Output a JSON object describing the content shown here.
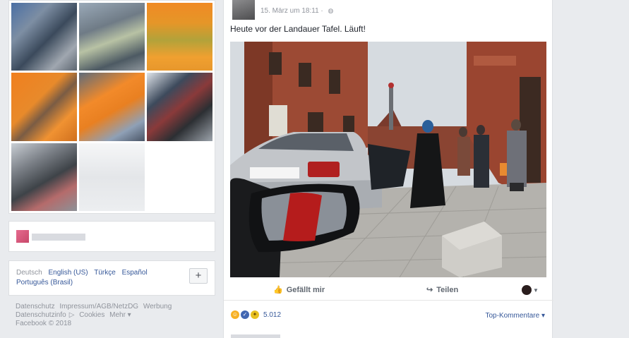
{
  "left": {
    "photos": [
      {
        "name": "photo-1"
      },
      {
        "name": "photo-2"
      },
      {
        "name": "photo-3"
      },
      {
        "name": "photo-4"
      },
      {
        "name": "photo-5"
      },
      {
        "name": "photo-6"
      },
      {
        "name": "photo-7"
      },
      {
        "name": "photo-8"
      },
      {
        "name": "photo-9"
      }
    ],
    "languages": [
      "Deutsch",
      "English (US)",
      "Türkçe",
      "Español",
      "Português (Brasil)"
    ],
    "lang_plus": "+",
    "footer": [
      "Datenschutz",
      "Impressum/AGB/NetzDG",
      "Werbung",
      "Datenschutzinfo",
      "Cookies",
      "Mehr ▾"
    ],
    "copyright": "Facebook © 2018"
  },
  "post": {
    "timestamp": "15. März um 18:11 ·",
    "globe_icon": "globe-icon",
    "text": "Heute vor der Landauer Tafel. Läuft!",
    "actions": {
      "like": "Gefällt mir",
      "share": "Teilen"
    },
    "reaction_count": "5.012",
    "top_comments": "Top-Kommentare ▾"
  },
  "colors": {
    "link": "#365899",
    "muted": "#90949c",
    "background": "#e9ebee"
  }
}
